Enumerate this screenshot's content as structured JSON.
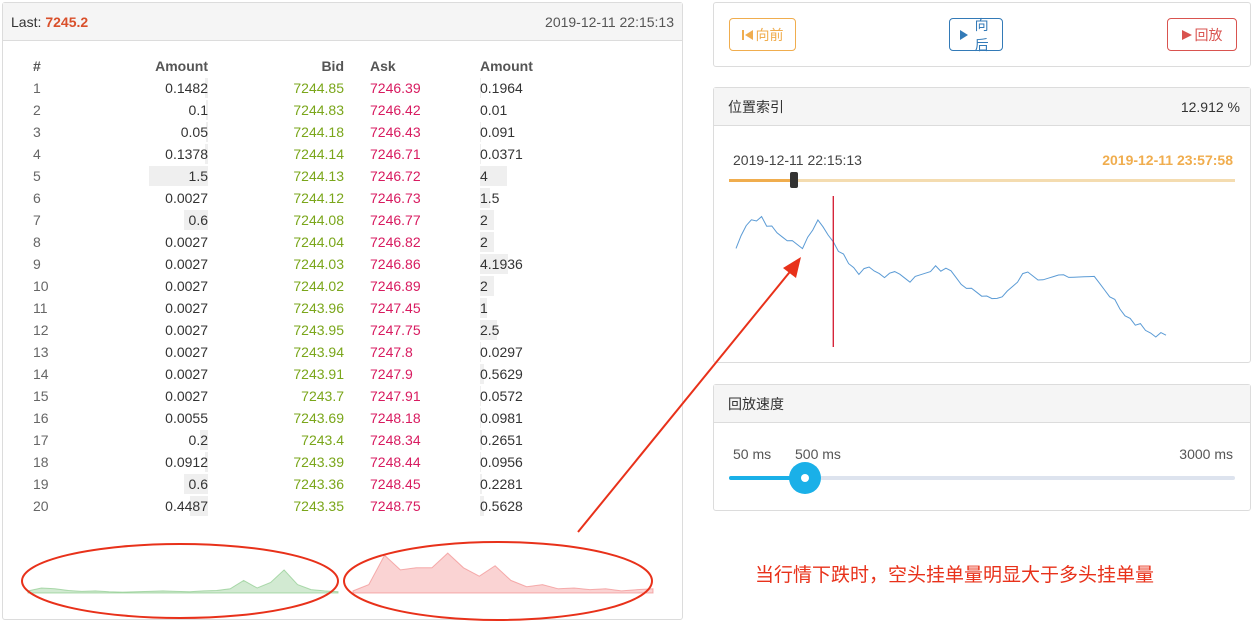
{
  "book": {
    "last_label": "Last:",
    "last_price": "7245.2",
    "timestamp": "2019-12-11 22:15:13",
    "headers": {
      "index": "#",
      "bid_amount": "Amount",
      "bid": "Bid",
      "ask": "Ask",
      "ask_amount": "Amount"
    },
    "rows": [
      {
        "i": "1",
        "ba": "0.1482",
        "b": "7244.85",
        "a": "7246.39",
        "aa": "0.1964",
        "bw": 0.02,
        "aw": 0.03
      },
      {
        "i": "2",
        "ba": "0.1",
        "b": "7244.83",
        "a": "7246.42",
        "aa": "0.01",
        "bw": 0.015,
        "aw": 0.0
      },
      {
        "i": "3",
        "ba": "0.05",
        "b": "7244.18",
        "a": "7246.43",
        "aa": "0.091",
        "bw": 0.01,
        "aw": 0.015
      },
      {
        "i": "4",
        "ba": "0.1378",
        "b": "7244.14",
        "a": "7246.71",
        "aa": "0.0371",
        "bw": 0.02,
        "aw": 0.01
      },
      {
        "i": "5",
        "ba": "1.5",
        "b": "7244.13",
        "a": "7246.72",
        "aa": "4",
        "bw": 0.37,
        "aw": 0.9
      },
      {
        "i": "6",
        "ba": "0.0027",
        "b": "7244.12",
        "a": "7246.73",
        "aa": "1.5",
        "bw": 0.0,
        "aw": 0.34
      },
      {
        "i": "7",
        "ba": "0.6",
        "b": "7244.08",
        "a": "7246.77",
        "aa": "2",
        "bw": 0.15,
        "aw": 0.45
      },
      {
        "i": "8",
        "ba": "0.0027",
        "b": "7244.04",
        "a": "7246.82",
        "aa": "2",
        "bw": 0.0,
        "aw": 0.45
      },
      {
        "i": "9",
        "ba": "0.0027",
        "b": "7244.03",
        "a": "7246.86",
        "aa": "4.1936",
        "bw": 0.0,
        "aw": 0.94
      },
      {
        "i": "10",
        "ba": "0.0027",
        "b": "7244.02",
        "a": "7246.89",
        "aa": "2",
        "bw": 0.0,
        "aw": 0.45
      },
      {
        "i": "11",
        "ba": "0.0027",
        "b": "7243.96",
        "a": "7247.45",
        "aa": "1",
        "bw": 0.0,
        "aw": 0.22
      },
      {
        "i": "12",
        "ba": "0.0027",
        "b": "7243.95",
        "a": "7247.75",
        "aa": "2.5",
        "bw": 0.0,
        "aw": 0.56
      },
      {
        "i": "13",
        "ba": "0.0027",
        "b": "7243.94",
        "a": "7247.8",
        "aa": "0.0297",
        "bw": 0.0,
        "aw": 0.01
      },
      {
        "i": "14",
        "ba": "0.0027",
        "b": "7243.91",
        "a": "7247.9",
        "aa": "0.5629",
        "bw": 0.0,
        "aw": 0.12
      },
      {
        "i": "15",
        "ba": "0.0027",
        "b": "7243.7",
        "a": "7247.91",
        "aa": "0.0572",
        "bw": 0.0,
        "aw": 0.01
      },
      {
        "i": "16",
        "ba": "0.0055",
        "b": "7243.69",
        "a": "7248.18",
        "aa": "0.0981",
        "bw": 0.0,
        "aw": 0.02
      },
      {
        "i": "17",
        "ba": "0.2",
        "b": "7243.4",
        "a": "7248.34",
        "aa": "0.2651",
        "bw": 0.05,
        "aw": 0.06
      },
      {
        "i": "18",
        "ba": "0.0912",
        "b": "7243.39",
        "a": "7248.44",
        "aa": "0.0956",
        "bw": 0.02,
        "aw": 0.02
      },
      {
        "i": "19",
        "ba": "0.6",
        "b": "7243.36",
        "a": "7248.45",
        "aa": "0.2281",
        "bw": 0.15,
        "aw": 0.05
      },
      {
        "i": "20",
        "ba": "0.4487",
        "b": "7243.35",
        "a": "7248.75",
        "aa": "0.5628",
        "bw": 0.11,
        "aw": 0.12
      }
    ]
  },
  "depth": {
    "bid_profile": [
      0.05,
      0.12,
      0.1,
      0.06,
      0.04,
      0.05,
      0.03,
      0.02,
      0.03,
      0.04,
      0.05,
      0.04,
      0.03,
      0.05,
      0.06,
      0.1,
      0.3,
      0.12,
      0.25,
      0.55,
      0.2,
      0.08,
      0.05,
      0.03
    ],
    "ask_profile": [
      0.05,
      0.2,
      0.9,
      0.55,
      0.6,
      0.6,
      0.95,
      0.6,
      0.4,
      0.65,
      0.3,
      0.15,
      0.2,
      0.1,
      0.12,
      0.08,
      0.1,
      0.05,
      0.08,
      0.1
    ],
    "bid_color": "#7fc47f",
    "ask_color": "#f08080"
  },
  "controls": {
    "prev_label": "向前",
    "next_label": "向后",
    "play_label": "回放",
    "prev_color": "#f0ad4e",
    "next_color": "#337ab7",
    "play_color": "#d9534f"
  },
  "position": {
    "title": "位置索引",
    "percent": "12.912 %",
    "start_time": "2019-12-11 22:15:13",
    "end_time": "2019-12-11 23:57:58",
    "progress": 0.12912,
    "price_line": [
      0.62,
      0.72,
      0.8,
      0.85,
      0.82,
      0.86,
      0.8,
      0.78,
      0.74,
      0.72,
      0.7,
      0.68,
      0.66,
      0.64,
      0.7,
      0.76,
      0.84,
      0.8,
      0.72,
      0.68,
      0.62,
      0.58,
      0.52,
      0.5,
      0.46,
      0.48,
      0.5,
      0.48,
      0.44,
      0.42,
      0.46,
      0.48,
      0.44,
      0.42,
      0.4,
      0.42,
      0.44,
      0.46,
      0.48,
      0.5,
      0.47,
      0.5,
      0.46,
      0.42,
      0.38,
      0.36,
      0.34,
      0.32,
      0.3,
      0.28,
      0.27,
      0.28,
      0.3,
      0.32,
      0.36,
      0.4,
      0.44,
      0.46,
      0.44,
      0.42,
      0.4,
      0.42,
      0.44,
      0.43,
      0.44,
      0.43,
      0.44,
      0.42,
      0.43,
      0.44,
      0.42,
      0.38,
      0.34,
      0.3,
      0.26,
      0.2,
      0.16,
      0.12,
      0.08,
      0.1,
      0.06,
      0.02,
      0.0,
      0.04,
      0.0
    ],
    "marker_index": 19,
    "line_color": "#5b9bd5",
    "marker_color": "#d0021b"
  },
  "speed": {
    "title": "回放速度",
    "min_label": "50 ms",
    "current_label": "500 ms",
    "max_label": "3000 ms",
    "value_ms": 500,
    "min_ms": 50,
    "max_ms": 3000
  },
  "annotation": {
    "text": "当行情下跌时，空头挂单量明显大于多头挂单量",
    "color": "#e8311a"
  }
}
